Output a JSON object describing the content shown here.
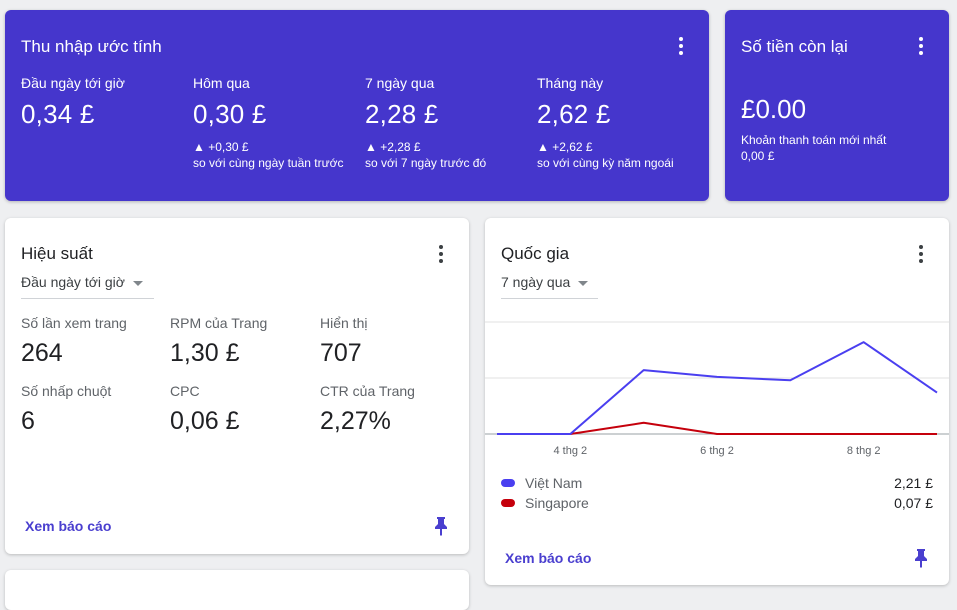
{
  "earnings": {
    "title": "Thu nhập ước tính",
    "stats": [
      {
        "label": "Đầu ngày tới giờ",
        "value": "0,34 £",
        "delta": "",
        "compare": ""
      },
      {
        "label": "Hôm qua",
        "value": "0,30 £",
        "delta": "▲ +0,30 £",
        "compare": "so với cùng ngày tuần trước"
      },
      {
        "label": "7 ngày qua",
        "value": "2,28 £",
        "delta": "▲ +2,28 £",
        "compare": "so với 7 ngày trước đó"
      },
      {
        "label": "Tháng này",
        "value": "2,62 £",
        "delta": "▲ +2,62 £",
        "compare": "so với cùng kỳ năm ngoái"
      }
    ]
  },
  "balance": {
    "title": "Số tiền còn lại",
    "value": "£0.00",
    "last_payment_label": "Khoản thanh toán mới nhất",
    "last_payment_value": "0,00 £"
  },
  "performance": {
    "title": "Hiệu suất",
    "range": "Đầu ngày tới giờ",
    "metrics": [
      {
        "label": "Số lần xem trang",
        "value": "264"
      },
      {
        "label": "RPM của Trang",
        "value": "1,30 £"
      },
      {
        "label": "Hiển thị",
        "value": "707"
      },
      {
        "label": "Số nhấp chuột",
        "value": "6"
      },
      {
        "label": "CPC",
        "value": "0,06 £"
      },
      {
        "label": "CTR của Trang",
        "value": "2,27%"
      }
    ],
    "report_link": "Xem báo cáo"
  },
  "country": {
    "title": "Quốc gia",
    "range": "7 ngày qua",
    "report_link": "Xem báo cáo",
    "legend": [
      {
        "name": "Việt Nam",
        "value": "2,21 £",
        "color": "#4a3ff0"
      },
      {
        "name": "Singapore",
        "value": "0,07 £",
        "color": "#c5000c"
      }
    ]
  },
  "chart_data": {
    "type": "line",
    "x": [
      "3 thg 2",
      "4 thg 2",
      "5 thg 2",
      "6 thg 2",
      "7 thg 2",
      "8 thg 2",
      "9 thg 2"
    ],
    "x_tick_labels": [
      "4 thg 2",
      "6 thg 2",
      "8 thg 2"
    ],
    "series": [
      {
        "name": "Việt Nam",
        "color": "#4a3ff0",
        "values": [
          0,
          0,
          0.57,
          0.51,
          0.48,
          0.82,
          0.37
        ]
      },
      {
        "name": "Singapore",
        "color": "#c5000c",
        "values": [
          0,
          0,
          0.1,
          0,
          0,
          0,
          0
        ]
      }
    ],
    "ylim": [
      0,
      1.0
    ],
    "grid": true,
    "legend": "bottom"
  },
  "colors": {
    "primary": "#4536cc",
    "accent": "#4a3fcf"
  }
}
